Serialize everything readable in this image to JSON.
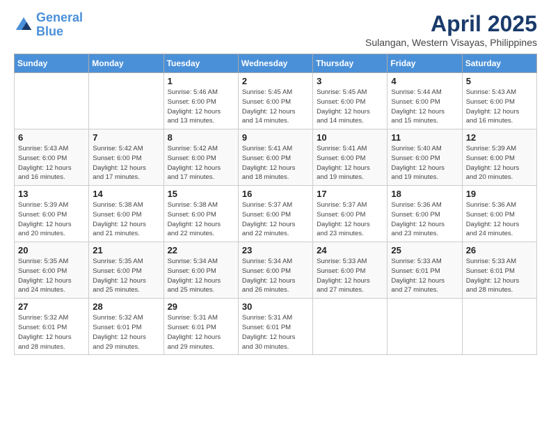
{
  "logo": {
    "line1": "General",
    "line2": "Blue"
  },
  "title": "April 2025",
  "subtitle": "Sulangan, Western Visayas, Philippines",
  "header_days": [
    "Sunday",
    "Monday",
    "Tuesday",
    "Wednesday",
    "Thursday",
    "Friday",
    "Saturday"
  ],
  "weeks": [
    [
      {
        "day": "",
        "info": ""
      },
      {
        "day": "",
        "info": ""
      },
      {
        "day": "1",
        "info": "Sunrise: 5:46 AM\nSunset: 6:00 PM\nDaylight: 12 hours\nand 13 minutes."
      },
      {
        "day": "2",
        "info": "Sunrise: 5:45 AM\nSunset: 6:00 PM\nDaylight: 12 hours\nand 14 minutes."
      },
      {
        "day": "3",
        "info": "Sunrise: 5:45 AM\nSunset: 6:00 PM\nDaylight: 12 hours\nand 14 minutes."
      },
      {
        "day": "4",
        "info": "Sunrise: 5:44 AM\nSunset: 6:00 PM\nDaylight: 12 hours\nand 15 minutes."
      },
      {
        "day": "5",
        "info": "Sunrise: 5:43 AM\nSunset: 6:00 PM\nDaylight: 12 hours\nand 16 minutes."
      }
    ],
    [
      {
        "day": "6",
        "info": "Sunrise: 5:43 AM\nSunset: 6:00 PM\nDaylight: 12 hours\nand 16 minutes."
      },
      {
        "day": "7",
        "info": "Sunrise: 5:42 AM\nSunset: 6:00 PM\nDaylight: 12 hours\nand 17 minutes."
      },
      {
        "day": "8",
        "info": "Sunrise: 5:42 AM\nSunset: 6:00 PM\nDaylight: 12 hours\nand 17 minutes."
      },
      {
        "day": "9",
        "info": "Sunrise: 5:41 AM\nSunset: 6:00 PM\nDaylight: 12 hours\nand 18 minutes."
      },
      {
        "day": "10",
        "info": "Sunrise: 5:41 AM\nSunset: 6:00 PM\nDaylight: 12 hours\nand 19 minutes."
      },
      {
        "day": "11",
        "info": "Sunrise: 5:40 AM\nSunset: 6:00 PM\nDaylight: 12 hours\nand 19 minutes."
      },
      {
        "day": "12",
        "info": "Sunrise: 5:39 AM\nSunset: 6:00 PM\nDaylight: 12 hours\nand 20 minutes."
      }
    ],
    [
      {
        "day": "13",
        "info": "Sunrise: 5:39 AM\nSunset: 6:00 PM\nDaylight: 12 hours\nand 20 minutes."
      },
      {
        "day": "14",
        "info": "Sunrise: 5:38 AM\nSunset: 6:00 PM\nDaylight: 12 hours\nand 21 minutes."
      },
      {
        "day": "15",
        "info": "Sunrise: 5:38 AM\nSunset: 6:00 PM\nDaylight: 12 hours\nand 22 minutes."
      },
      {
        "day": "16",
        "info": "Sunrise: 5:37 AM\nSunset: 6:00 PM\nDaylight: 12 hours\nand 22 minutes."
      },
      {
        "day": "17",
        "info": "Sunrise: 5:37 AM\nSunset: 6:00 PM\nDaylight: 12 hours\nand 23 minutes."
      },
      {
        "day": "18",
        "info": "Sunrise: 5:36 AM\nSunset: 6:00 PM\nDaylight: 12 hours\nand 23 minutes."
      },
      {
        "day": "19",
        "info": "Sunrise: 5:36 AM\nSunset: 6:00 PM\nDaylight: 12 hours\nand 24 minutes."
      }
    ],
    [
      {
        "day": "20",
        "info": "Sunrise: 5:35 AM\nSunset: 6:00 PM\nDaylight: 12 hours\nand 24 minutes."
      },
      {
        "day": "21",
        "info": "Sunrise: 5:35 AM\nSunset: 6:00 PM\nDaylight: 12 hours\nand 25 minutes."
      },
      {
        "day": "22",
        "info": "Sunrise: 5:34 AM\nSunset: 6:00 PM\nDaylight: 12 hours\nand 25 minutes."
      },
      {
        "day": "23",
        "info": "Sunrise: 5:34 AM\nSunset: 6:00 PM\nDaylight: 12 hours\nand 26 minutes."
      },
      {
        "day": "24",
        "info": "Sunrise: 5:33 AM\nSunset: 6:00 PM\nDaylight: 12 hours\nand 27 minutes."
      },
      {
        "day": "25",
        "info": "Sunrise: 5:33 AM\nSunset: 6:01 PM\nDaylight: 12 hours\nand 27 minutes."
      },
      {
        "day": "26",
        "info": "Sunrise: 5:33 AM\nSunset: 6:01 PM\nDaylight: 12 hours\nand 28 minutes."
      }
    ],
    [
      {
        "day": "27",
        "info": "Sunrise: 5:32 AM\nSunset: 6:01 PM\nDaylight: 12 hours\nand 28 minutes."
      },
      {
        "day": "28",
        "info": "Sunrise: 5:32 AM\nSunset: 6:01 PM\nDaylight: 12 hours\nand 29 minutes."
      },
      {
        "day": "29",
        "info": "Sunrise: 5:31 AM\nSunset: 6:01 PM\nDaylight: 12 hours\nand 29 minutes."
      },
      {
        "day": "30",
        "info": "Sunrise: 5:31 AM\nSunset: 6:01 PM\nDaylight: 12 hours\nand 30 minutes."
      },
      {
        "day": "",
        "info": ""
      },
      {
        "day": "",
        "info": ""
      },
      {
        "day": "",
        "info": ""
      }
    ]
  ]
}
